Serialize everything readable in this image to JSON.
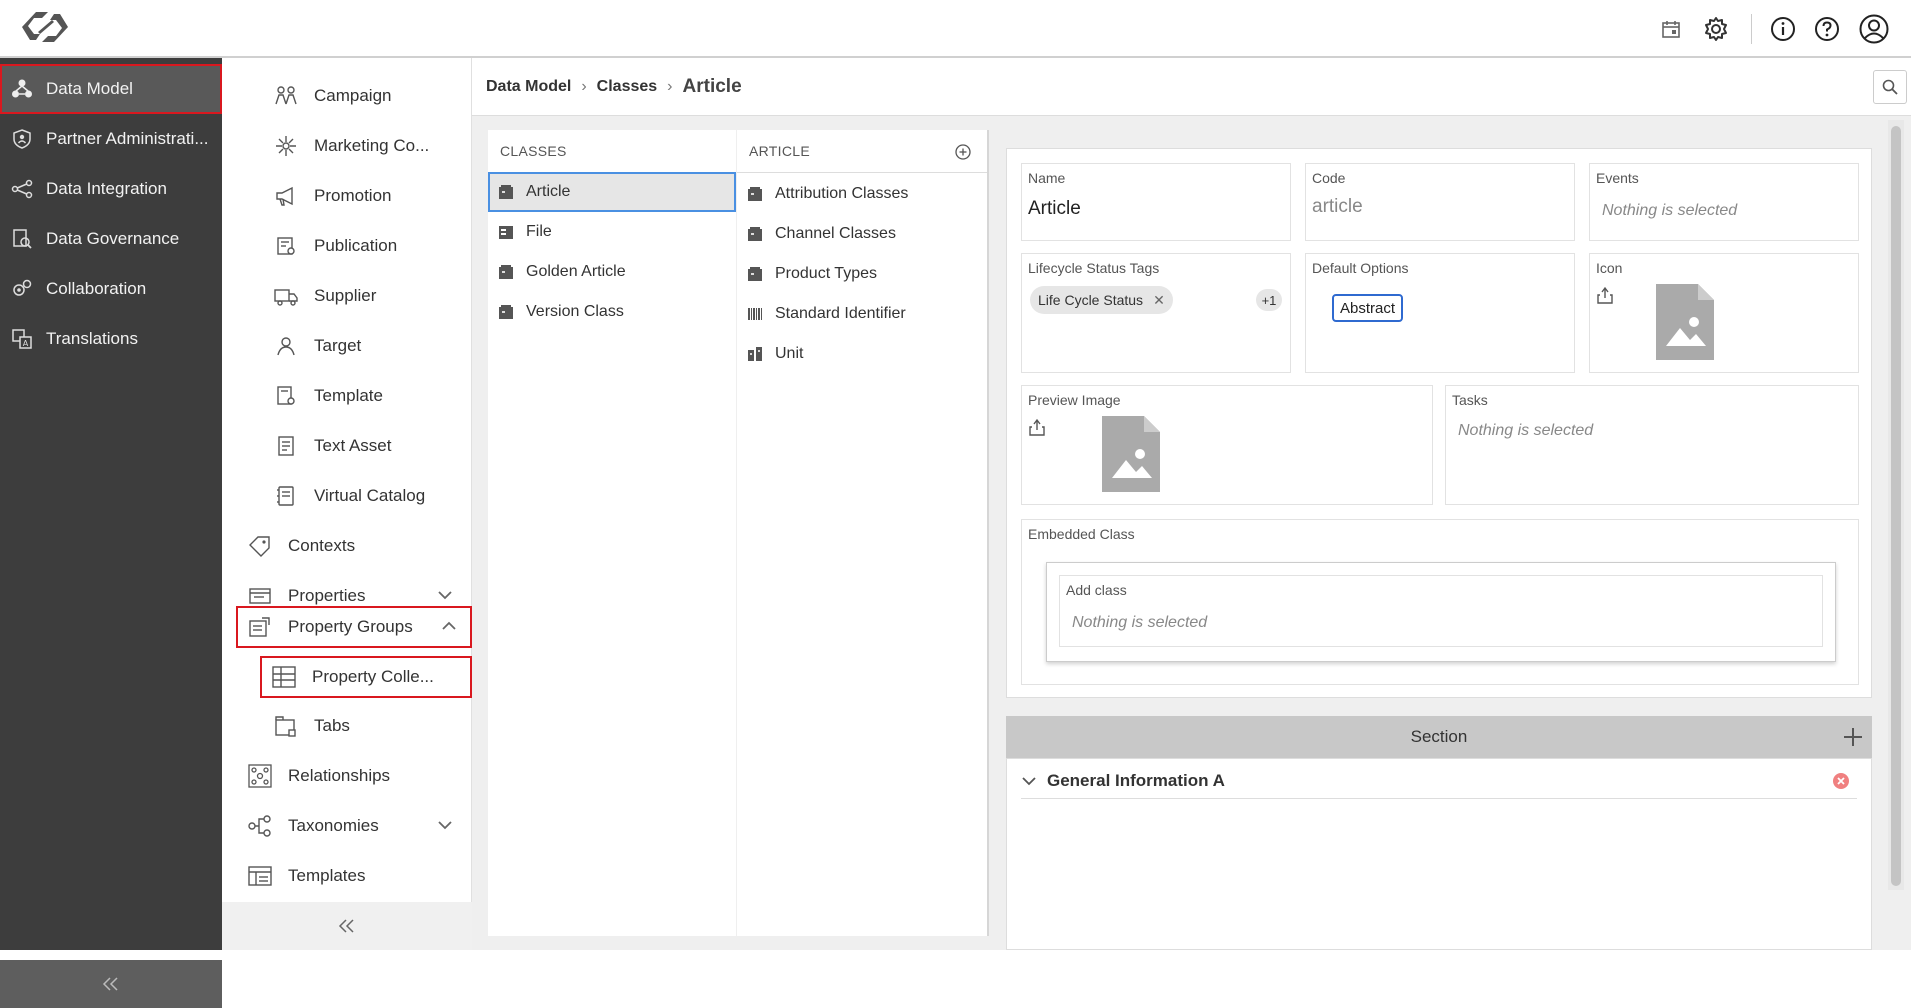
{
  "topbar": {
    "icons": [
      "logo-icon",
      "calendar-icon",
      "gear-icon",
      "info-icon",
      "help-icon",
      "user-icon"
    ]
  },
  "leftnav": {
    "items": [
      {
        "label": "Data Model",
        "icon": "data-model-icon"
      },
      {
        "label": "Partner Administrati...",
        "icon": "shield-icon"
      },
      {
        "label": "Data Integration",
        "icon": "integration-icon"
      },
      {
        "label": "Data Governance",
        "icon": "governance-icon"
      },
      {
        "label": "Collaboration",
        "icon": "collaboration-icon"
      },
      {
        "label": "Translations",
        "icon": "translations-icon"
      }
    ],
    "collapse_icon": "double-chevron-left-icon"
  },
  "subnav": {
    "items": [
      {
        "label": "Campaign"
      },
      {
        "label": "Marketing Co..."
      },
      {
        "label": "Promotion"
      },
      {
        "label": "Publication"
      },
      {
        "label": "Supplier"
      },
      {
        "label": "Target"
      },
      {
        "label": "Template"
      },
      {
        "label": "Text Asset"
      },
      {
        "label": "Virtual Catalog"
      },
      {
        "label": "Contexts"
      },
      {
        "label": "Properties"
      },
      {
        "label": "Property Groups"
      },
      {
        "label": "Property Colle..."
      },
      {
        "label": "Tabs"
      },
      {
        "label": "Relationships"
      },
      {
        "label": "Taxonomies"
      },
      {
        "label": "Templates"
      }
    ]
  },
  "breadcrumb": {
    "items": [
      "Data Model",
      "Classes"
    ],
    "current": "Article"
  },
  "classes": {
    "header": "CLASSES",
    "items": [
      "Article",
      "File",
      "Golden Article",
      "Version Class"
    ]
  },
  "article": {
    "header": "ARTICLE",
    "items": [
      "Attribution Classes",
      "Channel Classes",
      "Product Types",
      "Standard Identifier",
      "Unit"
    ]
  },
  "details": {
    "name_label": "Name",
    "name_value": "Article",
    "code_label": "Code",
    "code_value": "article",
    "events_label": "Events",
    "events_placeholder": "Nothing is selected",
    "lifecycle_label": "Lifecycle Status Tags",
    "lifecycle_chip": "Life Cycle Status",
    "lifecycle_more": "+1",
    "default_options_label": "Default Options",
    "default_option_tag": "Abstract",
    "icon_label": "Icon",
    "preview_label": "Preview Image",
    "tasks_label": "Tasks",
    "tasks_placeholder": "Nothing is selected",
    "embedded_label": "Embedded Class",
    "add_class_label": "Add class",
    "add_class_placeholder": "Nothing is selected"
  },
  "section": {
    "title": "Section",
    "group_title": "General Information A"
  }
}
